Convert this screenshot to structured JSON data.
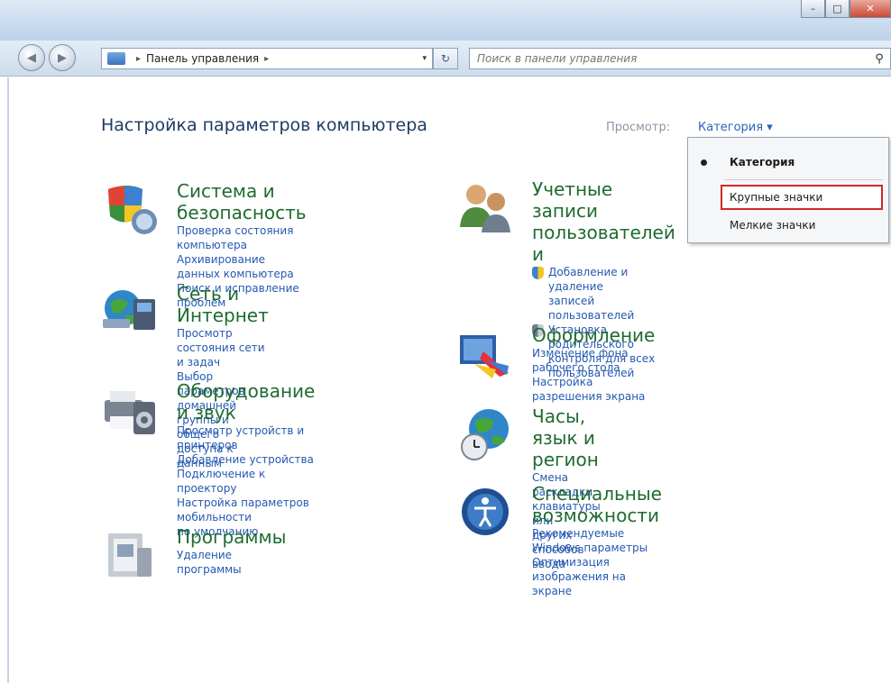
{
  "window": {
    "caption": {
      "minimize": "–",
      "maximize": "□",
      "close": "✕"
    }
  },
  "navigation": {
    "back_icon": "back-arrow-icon",
    "forward_icon": "forward-arrow-icon",
    "address": {
      "location": "Панель управления",
      "separator": "▸",
      "dropdown": "▾"
    },
    "refresh": "↻",
    "search": {
      "placeholder": "Поиск в панели управления",
      "icon": "search-icon"
    }
  },
  "page": {
    "title": "Настройка параметров компьютера",
    "view_label": "Просмотр:",
    "view_value": "Категория ▾"
  },
  "categories": {
    "system": {
      "title": "Система и безопасность",
      "links": [
        "Проверка состояния компьютера",
        "Архивирование данных компьютера",
        "Поиск и исправление проблем"
      ]
    },
    "network": {
      "title": "Сеть и Интернет",
      "links": [
        "Просмотр состояния сети и задач",
        "Выбор параметров домашней",
        "группы и общего доступа к данным"
      ]
    },
    "hardware": {
      "title": "Оборудование и звук",
      "links": [
        "Просмотр устройств и принтеров",
        "Добавление устройства",
        "Подключение к проектору",
        "Настройка параметров мобильности",
        "по умолчанию"
      ]
    },
    "programs": {
      "title": "Программы",
      "links": [
        "Удаление программы"
      ]
    },
    "users": {
      "title_line1": "Учетные записи",
      "title_line2": "пользователей и",
      "links": [
        "Добавление и удаление",
        "записей пользователей",
        "Установка родительского",
        "контроля для всех пользователей"
      ]
    },
    "appearance": {
      "title": "Оформление",
      "links": [
        "Изменение фона рабочего стола",
        "Настройка разрешения экрана"
      ]
    },
    "clock": {
      "title": "Часы, язык и регион",
      "links": [
        "Смена раскладки клавиатуры или",
        "других способов ввода"
      ]
    },
    "access": {
      "title": "Специальные возможности",
      "links": [
        "Рекомендуемые Windows параметры",
        "Оптимизация изображения на",
        "экране"
      ]
    }
  },
  "view_menu": {
    "items": [
      "Категория",
      "Крупные значки",
      "Мелкие значки"
    ],
    "selected": "Категория",
    "highlighted": "Крупные значки",
    "highlight_color": "#d32828"
  },
  "colors": {
    "category_title": "#1e6b2f",
    "link": "#2459b0",
    "page_title": "#1e3b66"
  }
}
